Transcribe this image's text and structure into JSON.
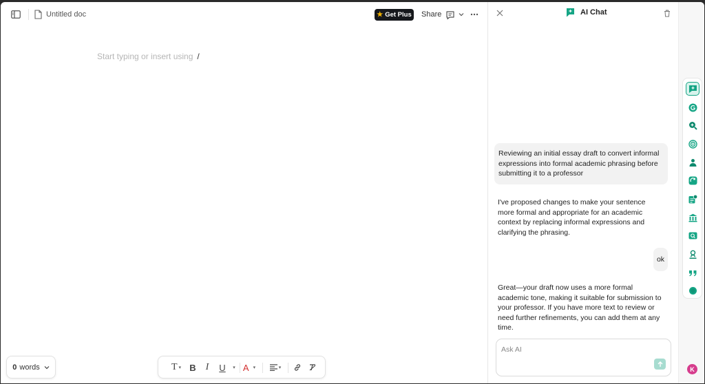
{
  "header": {
    "doc_title": "Untitled doc",
    "get_plus_label": "Get Plus",
    "share_label": "Share"
  },
  "editor": {
    "placeholder": "Start typing or insert using",
    "slash_hint": "/"
  },
  "word_count": {
    "count": "0",
    "unit": "words"
  },
  "format_toolbar": {
    "text_style": "T",
    "bold": "B",
    "italic": "I",
    "underline": "U",
    "text_color": "A"
  },
  "chat": {
    "title": "AI Chat",
    "messages": [
      {
        "role": "user",
        "text": "Reviewing an initial essay draft to convert informal expressions into formal academic phrasing before submitting it to a professor"
      },
      {
        "role": "assistant",
        "text": "I've proposed changes to make your sentence more formal and appropriate for an academic context by replacing informal expressions and clarifying the phrasing."
      },
      {
        "role": "user",
        "text": "ok"
      },
      {
        "role": "assistant",
        "text": "Great—your draft now uses a more formal academic tone, making it suitable for submission to your professor. If you have more text to review or need further refinements, you can add them at any time."
      }
    ],
    "input_placeholder": "Ask AI"
  },
  "avatar_initial": "K",
  "colors": {
    "brand": "#15a585",
    "brand_dark": "#0e8a6e",
    "get_plus_bg": "#16181c",
    "avatar": "#d63d8d",
    "text_color_red": "#d32f2f"
  },
  "rail_icons": [
    "ai-chat-icon",
    "grammarly-g-icon",
    "zoom-in-icon",
    "target-icon",
    "person-icon",
    "refresh-icon",
    "score-icon",
    "library-icon",
    "find-icon",
    "user-badge-icon",
    "quote-icon",
    "circle-icon"
  ]
}
